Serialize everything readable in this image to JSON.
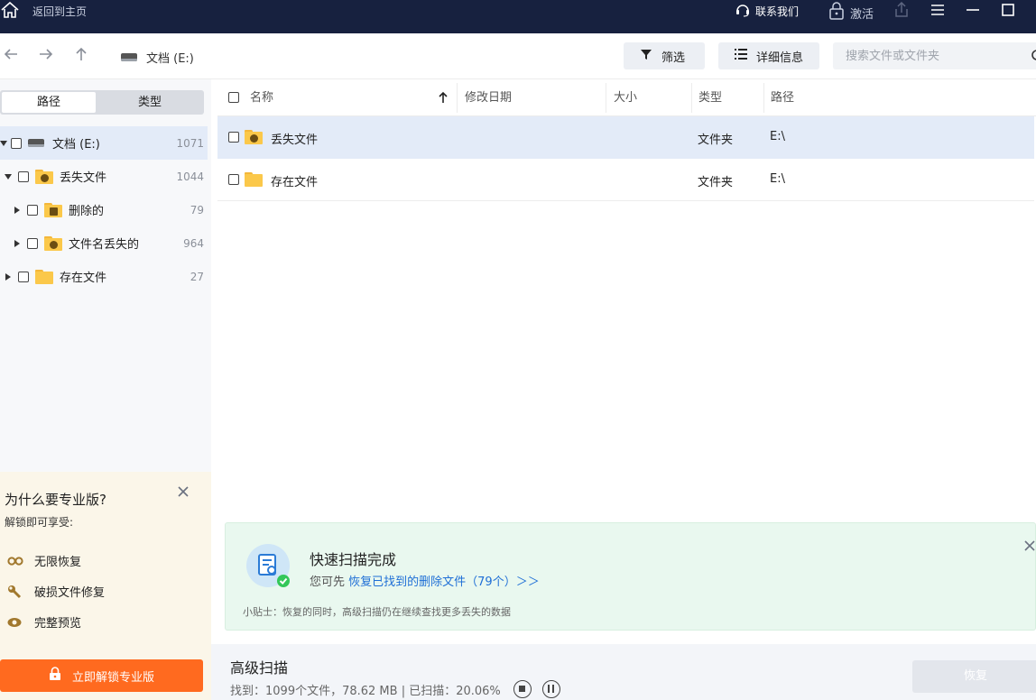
{
  "titlebar": {
    "back_label": "返回到主页",
    "contact_label": "联系我们",
    "activate_label": "激活"
  },
  "toolbar": {
    "drive_label": "文档 (E:)",
    "filter_label": "筛选",
    "details_label": "详细信息",
    "search_placeholder": "搜索文件或文件夹"
  },
  "left_panel": {
    "tabs": [
      {
        "label": "路径",
        "active": true
      },
      {
        "label": "类型",
        "active": false
      }
    ],
    "tree": [
      {
        "label": "文档 (E:)",
        "count": "1071",
        "icon": "drive-icon",
        "expanded": true,
        "selected": true
      },
      {
        "label": "丢失文件",
        "count": "1044",
        "icon": "lost-folder-icon",
        "expanded": true
      },
      {
        "label": "删除的",
        "count": "79",
        "icon": "deleted-folder-icon",
        "expanded": false
      },
      {
        "label": "文件名丢失的",
        "count": "964",
        "icon": "unknown-folder-icon",
        "expanded": false
      },
      {
        "label": "存在文件",
        "count": "27",
        "icon": "folder-icon",
        "expanded": false
      }
    ]
  },
  "promo": {
    "title": "为什么要专业版?",
    "subtitle": "解锁即可享受:",
    "features": [
      {
        "label": "无限恢复",
        "icon": "infinity-icon"
      },
      {
        "label": "破损文件修复",
        "icon": "wrench-icon"
      },
      {
        "label": "完整预览",
        "icon": "eye-icon"
      }
    ],
    "unlock_label": "立即解锁专业版"
  },
  "file_list": {
    "columns": [
      "名称",
      "修改日期",
      "大小",
      "类型",
      "路径"
    ],
    "rows": [
      {
        "name": "丢失文件",
        "date": "",
        "size": "",
        "type": "文件夹",
        "path": "E:\\",
        "icon": "lost-folder-icon",
        "selected": true
      },
      {
        "name": "存在文件",
        "date": "",
        "size": "",
        "type": "文件夹",
        "path": "E:\\",
        "icon": "folder-icon",
        "selected": false
      }
    ]
  },
  "scan_complete": {
    "title": "快速扫描完成",
    "prefix": "您可先",
    "link": "恢复已找到的删除文件（79个）＞＞",
    "tip": "小贴士：恢复的同时，高级扫描仍在继续查找更多丢失的数据"
  },
  "bottom_bar": {
    "title": "高级扫描",
    "found": "找到：1099个文件，78.62 MB | 已扫描：20.06%",
    "recover_label": "恢复"
  },
  "colors": {
    "titlebar_bg": "#17213f",
    "accent_orange": "#ff6a1f",
    "link_blue": "#1f6fd6",
    "selection": "#e3ebf8",
    "scan_bg": "#e9f8ef"
  }
}
